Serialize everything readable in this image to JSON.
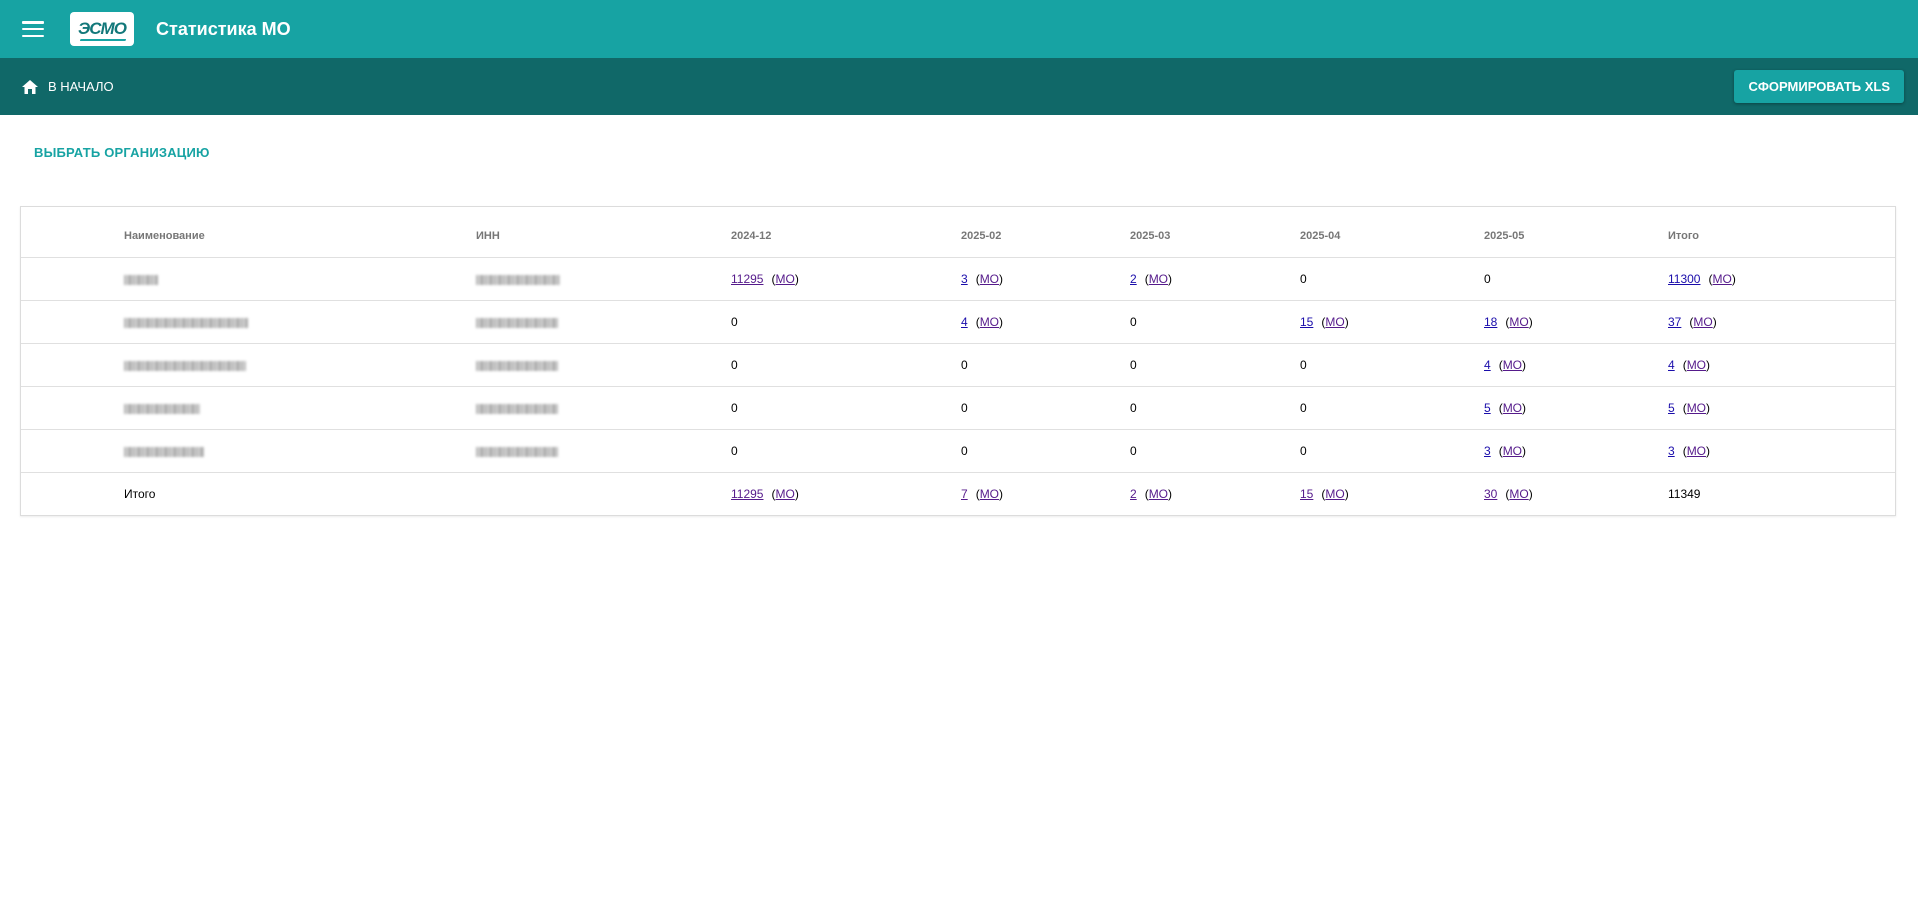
{
  "header": {
    "logo_text": "ЭСМО",
    "title": "Статистика МО"
  },
  "subbar": {
    "home_label": "В НАЧАЛО",
    "xls_button": "СФОРМИРОВАТЬ XLS"
  },
  "choose_org_label": "ВЫБРАТЬ ОРГАНИЗАЦИЮ",
  "table": {
    "columns": [
      "Наименование",
      "ИНН",
      "2024-12",
      "2025-02",
      "2025-03",
      "2025-04",
      "2025-05",
      "Итого"
    ],
    "mo_label": "МО",
    "rows": [
      {
        "values": [
          "11295",
          "3",
          "2",
          "0",
          "0",
          "11300"
        ]
      },
      {
        "values": [
          "0",
          "4",
          "0",
          "15",
          "18",
          "37"
        ]
      },
      {
        "values": [
          "0",
          "0",
          "0",
          "0",
          "4",
          "4"
        ]
      },
      {
        "values": [
          "0",
          "0",
          "0",
          "0",
          "5",
          "5"
        ]
      },
      {
        "values": [
          "0",
          "0",
          "0",
          "0",
          "3",
          "3"
        ]
      }
    ],
    "total": {
      "label": "Итого",
      "values": [
        "11295",
        "7",
        "2",
        "15",
        "30",
        "11349"
      ]
    }
  },
  "colors": {
    "topbar": "#17a3a3",
    "subbar": "#106868",
    "accent": "#17a3a3"
  }
}
